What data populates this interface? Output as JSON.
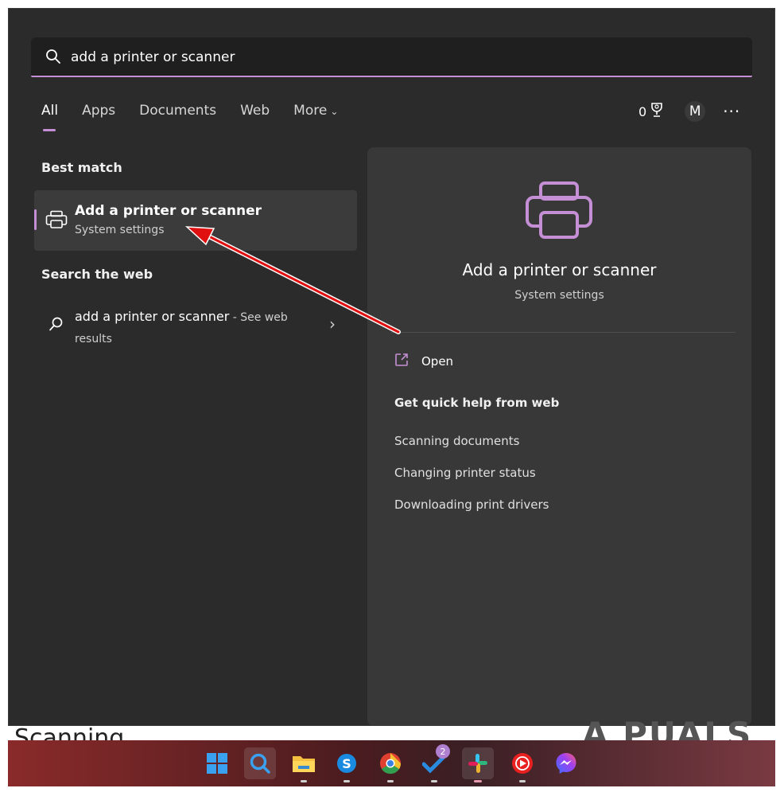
{
  "search": {
    "query": "add a printer or scanner"
  },
  "tabs": [
    {
      "label": "All",
      "active": true
    },
    {
      "label": "Apps"
    },
    {
      "label": "Documents"
    },
    {
      "label": "Web"
    },
    {
      "label": "More"
    }
  ],
  "header_tools": {
    "points": "0",
    "avatar_initial": "M"
  },
  "best_match": {
    "heading": "Best match",
    "title": "Add a printer or scanner",
    "subtitle": "System settings"
  },
  "search_web": {
    "heading": "Search the web",
    "query": "add a printer or scanner",
    "suffix": " - See web results"
  },
  "preview": {
    "title": "Add a printer or scanner",
    "subtitle": "System settings",
    "open_label": "Open",
    "help_heading": "Get quick help from web",
    "help_links": [
      "Scanning documents",
      "Changing printer status",
      "Downloading print drivers"
    ]
  },
  "taskbar": {
    "todo_badge": "2"
  },
  "page_text": "Scanning",
  "watermark": "A PUALS",
  "colors": {
    "accent": "#c58fd6",
    "panel": "#2b2b2b",
    "preview_panel": "#383838",
    "arrow": "#e01010"
  }
}
